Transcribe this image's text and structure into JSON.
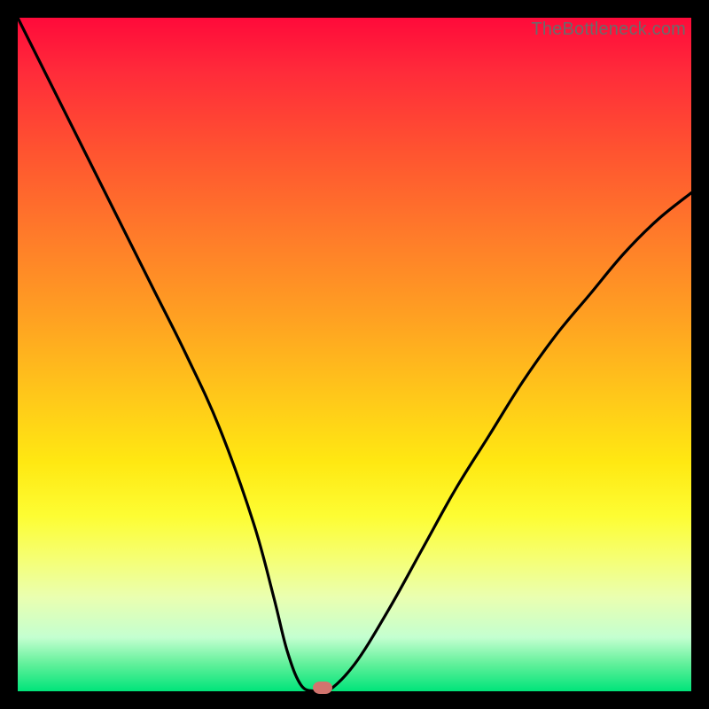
{
  "watermark": "TheBottleneck.com",
  "chart_data": {
    "type": "line",
    "title": "",
    "xlabel": "",
    "ylabel": "",
    "xlim": [
      0,
      100
    ],
    "ylim": [
      0,
      100
    ],
    "series": [
      {
        "name": "bottleneck-curve",
        "x": [
          0,
          5,
          10,
          15,
          20,
          25,
          30,
          35,
          38,
          40,
          42,
          44,
          46,
          50,
          55,
          60,
          65,
          70,
          75,
          80,
          85,
          90,
          95,
          100
        ],
        "values": [
          100,
          90,
          80,
          70,
          60,
          50,
          39,
          25,
          14,
          6,
          1,
          0,
          0,
          4,
          12,
          21,
          30,
          38,
          46,
          53,
          59,
          65,
          70,
          74
        ]
      }
    ],
    "marker": {
      "x": 45.2,
      "y": 0.5
    },
    "gradient_stops": [
      {
        "pct": 0,
        "color": "#ff0a3a"
      },
      {
        "pct": 50,
        "color": "#ffc71a"
      },
      {
        "pct": 75,
        "color": "#fdfd33"
      },
      {
        "pct": 100,
        "color": "#00e47a"
      }
    ]
  }
}
